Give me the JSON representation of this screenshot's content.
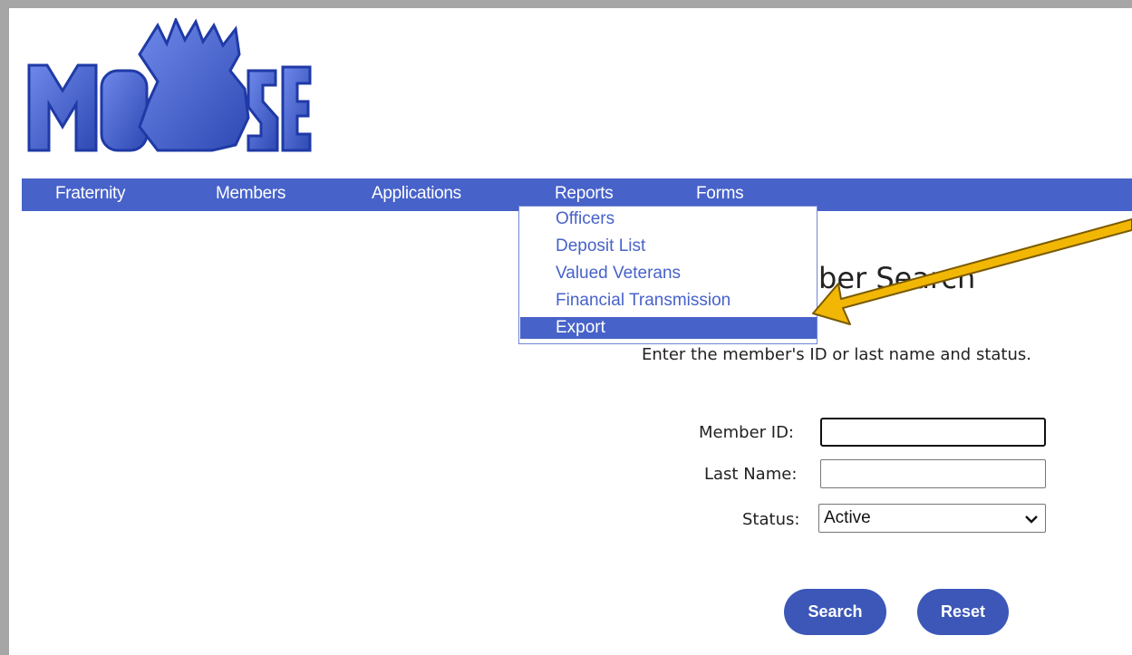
{
  "nav": {
    "items": [
      {
        "label": "Fraternity"
      },
      {
        "label": "Members"
      },
      {
        "label": "Applications"
      },
      {
        "label": "Reports"
      },
      {
        "label": "Forms"
      }
    ]
  },
  "reports_menu": {
    "items": [
      {
        "label": "Officers"
      },
      {
        "label": "Deposit List"
      },
      {
        "label": "Valued Veterans"
      },
      {
        "label": "Financial Transmission"
      },
      {
        "label": "Export",
        "selected": true
      }
    ]
  },
  "page": {
    "heading_visible": "ber Search",
    "instructions_visible": "Enter the member's ID or last name and status."
  },
  "form": {
    "member_id_label": "Member ID:",
    "member_id_value": "",
    "last_name_label": "Last Name:",
    "last_name_value": "",
    "status_label": "Status:",
    "status_value": "Active"
  },
  "buttons": {
    "search_label": "Search",
    "reset_label": "Reset"
  },
  "logo": {
    "text": "MOOSE"
  },
  "colors": {
    "nav_bg": "#4762c9",
    "link": "#4762c9",
    "button_bg": "#3c57b7",
    "annotation_arrow": "#f2b705"
  },
  "icons": {
    "select_chevron": "chevron-down-icon",
    "annotation": "arrow-icon"
  }
}
